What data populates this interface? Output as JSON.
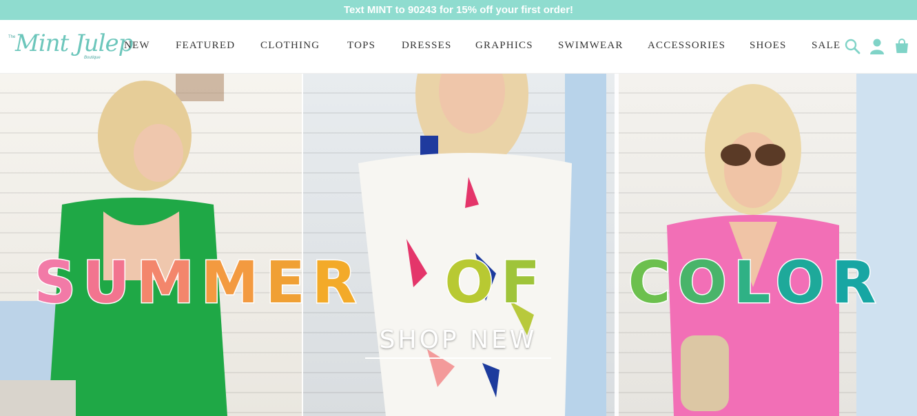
{
  "promo": {
    "text": "Text MINT to 90243 for 15% off your first order!"
  },
  "logo": {
    "small_top": "The",
    "name": "Mint Julep",
    "small_bottom": "Boutique"
  },
  "nav": {
    "items": [
      "NEW",
      "FEATURED",
      "CLOTHING",
      "TOPS",
      "DRESSES",
      "GRAPHICS",
      "SWIMWEAR",
      "ACCESSORIES",
      "SHOES",
      "SALE"
    ]
  },
  "icons": {
    "search": "search-icon",
    "account": "user-icon",
    "cart": "shopping-bag-icon",
    "color": "#7fd3c7"
  },
  "hero": {
    "title_words": [
      {
        "text": "SUMMER",
        "colors": [
          "#f27aa7",
          "#f2748f",
          "#f3866c",
          "#f39a40",
          "#f0a034",
          "#f3aa29"
        ]
      },
      {
        "text": "OF",
        "colors": [
          "#b8c932",
          "#9fc43a"
        ]
      },
      {
        "text": "COLOR",
        "colors": [
          "#6cc04e",
          "#49b46a",
          "#2fb185",
          "#1ea99a",
          "#17a6a3"
        ]
      }
    ],
    "cta": "SHOP NEW"
  },
  "colors": {
    "promo_bg": "#8fdccf",
    "accent": "#7fd3c7"
  }
}
